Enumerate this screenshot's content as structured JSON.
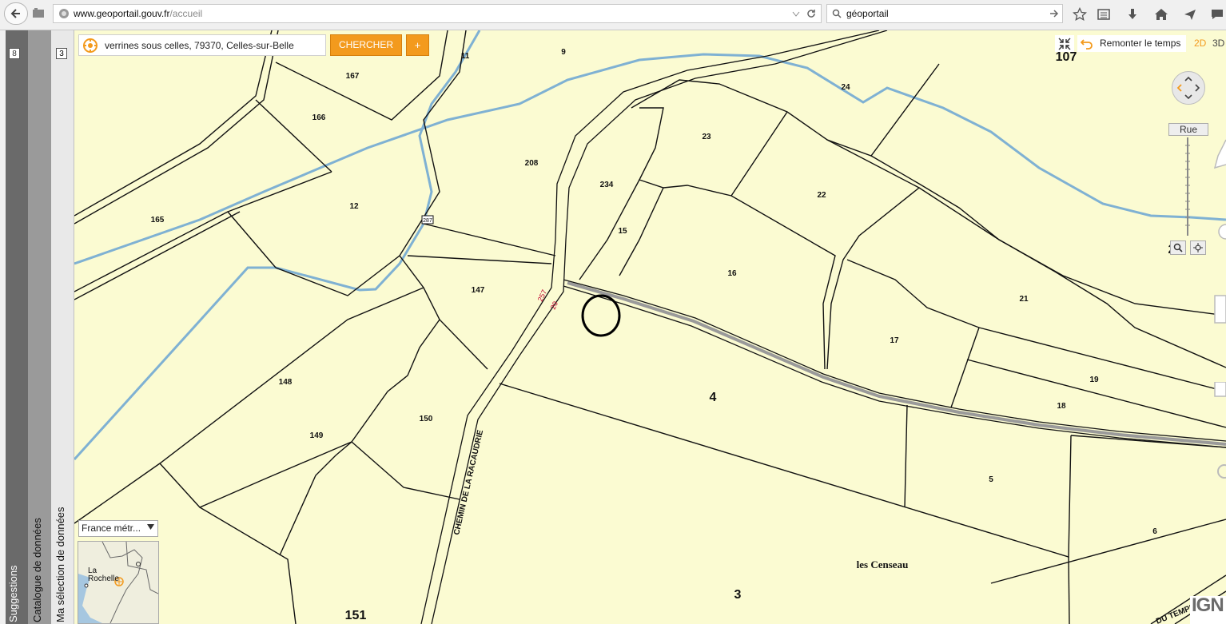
{
  "browser": {
    "url_host": "www.geoportail.gouv.fr",
    "url_path": "/accueil",
    "search_query": "géoportail"
  },
  "sidebars": [
    {
      "label": "Suggestions",
      "count": "8"
    },
    {
      "label": "Catalogue de données"
    },
    {
      "label": "Ma sélection de données",
      "count": "3"
    }
  ],
  "search": {
    "address_value": "verrines sous celles, 79370, Celles-sur-Belle",
    "search_label": "CHERCHER",
    "plus_label": "+"
  },
  "toolbar": {
    "time_label": "Remonter le temps",
    "mode_2d": "2D",
    "mode_3d": "3D",
    "rue_label": "Rue"
  },
  "region_select": {
    "value": "France métr..."
  },
  "minimap": {
    "city_label": "La Rochelle"
  },
  "logo": {
    "text": "IGN"
  },
  "map": {
    "parcels": [
      "9",
      "11",
      "167",
      "166",
      "165",
      "12",
      "208",
      "234",
      "15",
      "23",
      "24",
      "22",
      "147",
      "16",
      "21",
      "17",
      "4",
      "19",
      "18",
      "148",
      "149",
      "150",
      "5",
      "6",
      "3",
      "151",
      "107"
    ],
    "lieu_dit": "les Censeau",
    "road_name": "CHEMIN DE LA RACAUDRIE",
    "road_name_2": "DU TEMPLE",
    "clipped_label": "2",
    "road_marks": [
      "257",
      "20",
      "287"
    ]
  },
  "colors": {
    "parcel_fill": "#fbfbd2",
    "river": "#7fb1d3",
    "accent": "#f39a1d"
  }
}
